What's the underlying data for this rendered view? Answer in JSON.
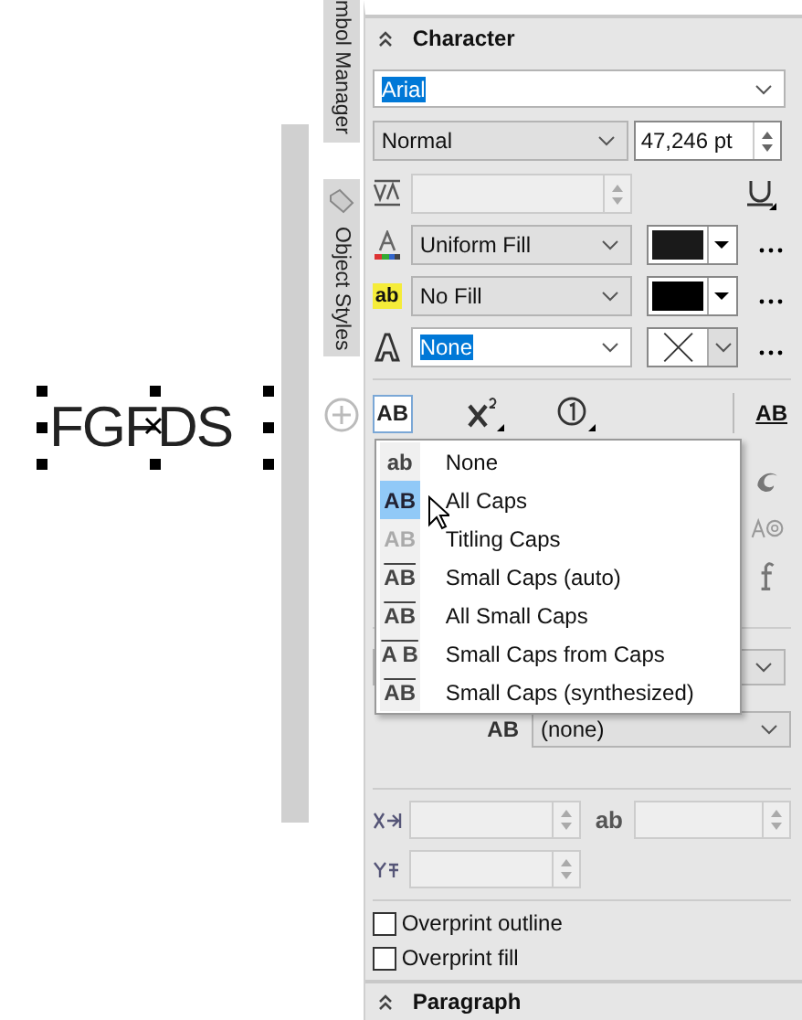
{
  "canvas": {
    "text": "FGFDS"
  },
  "docker_tabs": [
    {
      "label": "mbol Manager"
    },
    {
      "label": "Object Styles"
    }
  ],
  "character": {
    "title": "Character",
    "expanded": true,
    "font": {
      "value": "Arial",
      "selected": true
    },
    "style": "Normal",
    "size": "47,246 pt",
    "kerning": {
      "disabled": true
    },
    "fill_rows": [
      {
        "kind": "fill",
        "value": "Uniform Fill",
        "color": "#1a1a1a",
        "selected": false
      },
      {
        "kind": "background",
        "icon": "ab",
        "value": "No Fill",
        "color": "#000000",
        "selected": false
      },
      {
        "kind": "outline",
        "value": "None",
        "selected": true
      }
    ],
    "toolbar": {
      "caps_button": {
        "label": "AB",
        "pressed": true
      },
      "underline_label": "AB"
    },
    "caps_menu": [
      {
        "kind": "lower",
        "icon": "ab",
        "label": "None",
        "selected": false
      },
      {
        "kind": "caps",
        "icon": "AB",
        "label": "All Caps",
        "selected": true
      },
      {
        "kind": "titling",
        "icon": "AB",
        "label": "Titling Caps",
        "selected": false
      },
      {
        "kind": "small",
        "icon": "AB",
        "label": "Small Caps (auto)",
        "selected": false
      },
      {
        "kind": "allsmall",
        "icon": "AB",
        "label": "All Small Caps",
        "selected": false
      },
      {
        "kind": "fromcaps",
        "icon": "A B",
        "label": "Small Caps from Caps",
        "selected": false
      },
      {
        "kind": "small",
        "icon": "AB",
        "label": "Small Caps (synthesized)",
        "selected": false
      }
    ],
    "script_label": "AB",
    "script_value": "(none)",
    "offset_icon": "ab",
    "checkboxes": [
      {
        "label": "Overprint outline",
        "checked": false
      },
      {
        "label": "Overprint fill",
        "checked": false
      }
    ]
  },
  "paragraph": {
    "title": "Paragraph"
  }
}
